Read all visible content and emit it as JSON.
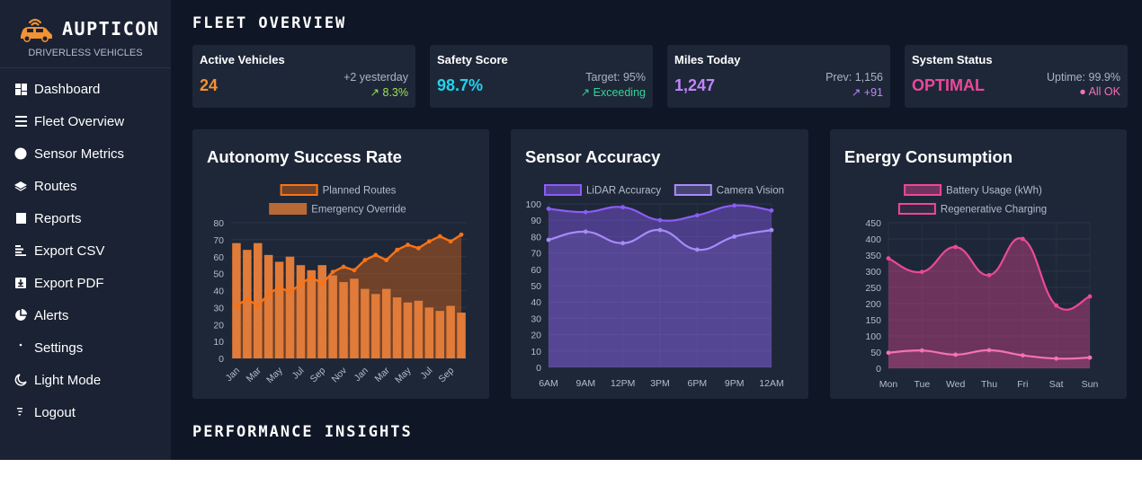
{
  "brand": {
    "name": "AUPTICON",
    "subtitle": "DRIVERLESS VEHICLES"
  },
  "sidebar": {
    "items": [
      {
        "label": "Dashboard",
        "icon": "dashboard-icon"
      },
      {
        "label": "Fleet Overview",
        "icon": "list-icon"
      },
      {
        "label": "Sensor Metrics",
        "icon": "circle-icon"
      },
      {
        "label": "Routes",
        "icon": "layers-icon"
      },
      {
        "label": "Reports",
        "icon": "square-icon"
      },
      {
        "label": "Export CSV",
        "icon": "csv-icon"
      },
      {
        "label": "Export PDF",
        "icon": "pdf-download-icon"
      },
      {
        "label": "Alerts",
        "icon": "pie-icon"
      },
      {
        "label": "Settings",
        "icon": "settings-icon"
      },
      {
        "label": "Light Mode",
        "icon": "moon-icon"
      },
      {
        "label": "Logout",
        "icon": "logout-icon"
      }
    ]
  },
  "main": {
    "overview_title": "FLEET OVERVIEW",
    "insights_title": "PERFORMANCE INSIGHTS"
  },
  "kpis": [
    {
      "label": "Active Vehicles",
      "value": "24",
      "value_color": "#f39233",
      "right1": "+2 yesterday",
      "right2": "↗ 8.3%",
      "right2_color": "#9ee44e"
    },
    {
      "label": "Safety Score",
      "value": "98.7%",
      "value_color": "#22d3ee",
      "right1": "Target: 95%",
      "right2": "↗ Exceeding",
      "right2_color": "#34d399"
    },
    {
      "label": "Miles Today",
      "value": "1,247",
      "value_color": "#c084fc",
      "right1": "Prev: 1,156",
      "right2": "↗ +91",
      "right2_color": "#c084fc"
    },
    {
      "label": "System Status",
      "value": "OPTIMAL",
      "value_color": "#ec4899",
      "right1": "Uptime: 99.9%",
      "right2": "● All OK",
      "right2_color": "#f472b6"
    }
  ],
  "chart_data": [
    {
      "type": "bar",
      "title": "Autonomy Success Rate",
      "categories": [
        "Jan",
        "Feb",
        "Mar",
        "Apr",
        "May",
        "Jun",
        "Jul",
        "Aug",
        "Sep",
        "Oct",
        "Nov",
        "Dec",
        "Jan",
        "Feb",
        "Mar",
        "Apr",
        "May",
        "Jun",
        "Jul",
        "Aug",
        "Sep",
        "Oct"
      ],
      "tick_labels": [
        "Jan",
        "Mar",
        "May",
        "Jul",
        "Sep",
        "Nov",
        "Jan",
        "Mar",
        "May",
        "Jul",
        "Sep"
      ],
      "ylim": [
        0,
        80
      ],
      "yticks": [
        0,
        10,
        20,
        30,
        40,
        50,
        60,
        70,
        80
      ],
      "series": [
        {
          "name": "Planned Routes",
          "kind": "line-area",
          "color": "#f97316",
          "fill": "rgba(180,90,30,0.55)",
          "values": [
            31,
            35,
            31,
            38,
            42,
            39,
            44,
            48,
            44,
            51,
            54,
            52,
            58,
            61,
            58,
            64,
            67,
            65,
            69,
            72,
            69,
            73
          ]
        },
        {
          "name": "Emergency Override",
          "kind": "bar",
          "color": "#e07b39",
          "values": [
            68,
            64,
            68,
            61,
            57,
            60,
            55,
            52,
            55,
            49,
            45,
            47,
            41,
            38,
            41,
            36,
            33,
            34,
            30,
            28,
            31,
            27
          ]
        }
      ]
    },
    {
      "type": "area",
      "title": "Sensor Accuracy",
      "categories": [
        "6AM",
        "9AM",
        "12PM",
        "3PM",
        "6PM",
        "9PM",
        "12AM"
      ],
      "ylim": [
        0,
        100
      ],
      "yticks": [
        0,
        10,
        20,
        30,
        40,
        50,
        60,
        70,
        80,
        90,
        100
      ],
      "series": [
        {
          "name": "LiDAR Accuracy",
          "color": "#8b5cf6",
          "values": [
            97,
            95,
            98,
            90,
            93,
            99,
            96
          ]
        },
        {
          "name": "Camera Vision",
          "color": "#a78bfa",
          "values": [
            78,
            83,
            76,
            84,
            72,
            80,
            84
          ]
        }
      ]
    },
    {
      "type": "area",
      "title": "Energy Consumption",
      "categories": [
        "Mon",
        "Tue",
        "Wed",
        "Thu",
        "Fri",
        "Sat",
        "Sun"
      ],
      "ylim": [
        0,
        450
      ],
      "yticks": [
        0,
        50,
        100,
        150,
        200,
        250,
        300,
        350,
        400,
        450
      ],
      "series": [
        {
          "name": "Battery Usage (kWh)",
          "color": "#ec4899",
          "values": [
            340,
            298,
            375,
            288,
            400,
            194,
            222
          ]
        },
        {
          "name": "Regenerative Charging",
          "color": "#f472b6",
          "values": [
            48,
            55,
            42,
            56,
            40,
            30,
            33
          ]
        }
      ]
    }
  ]
}
